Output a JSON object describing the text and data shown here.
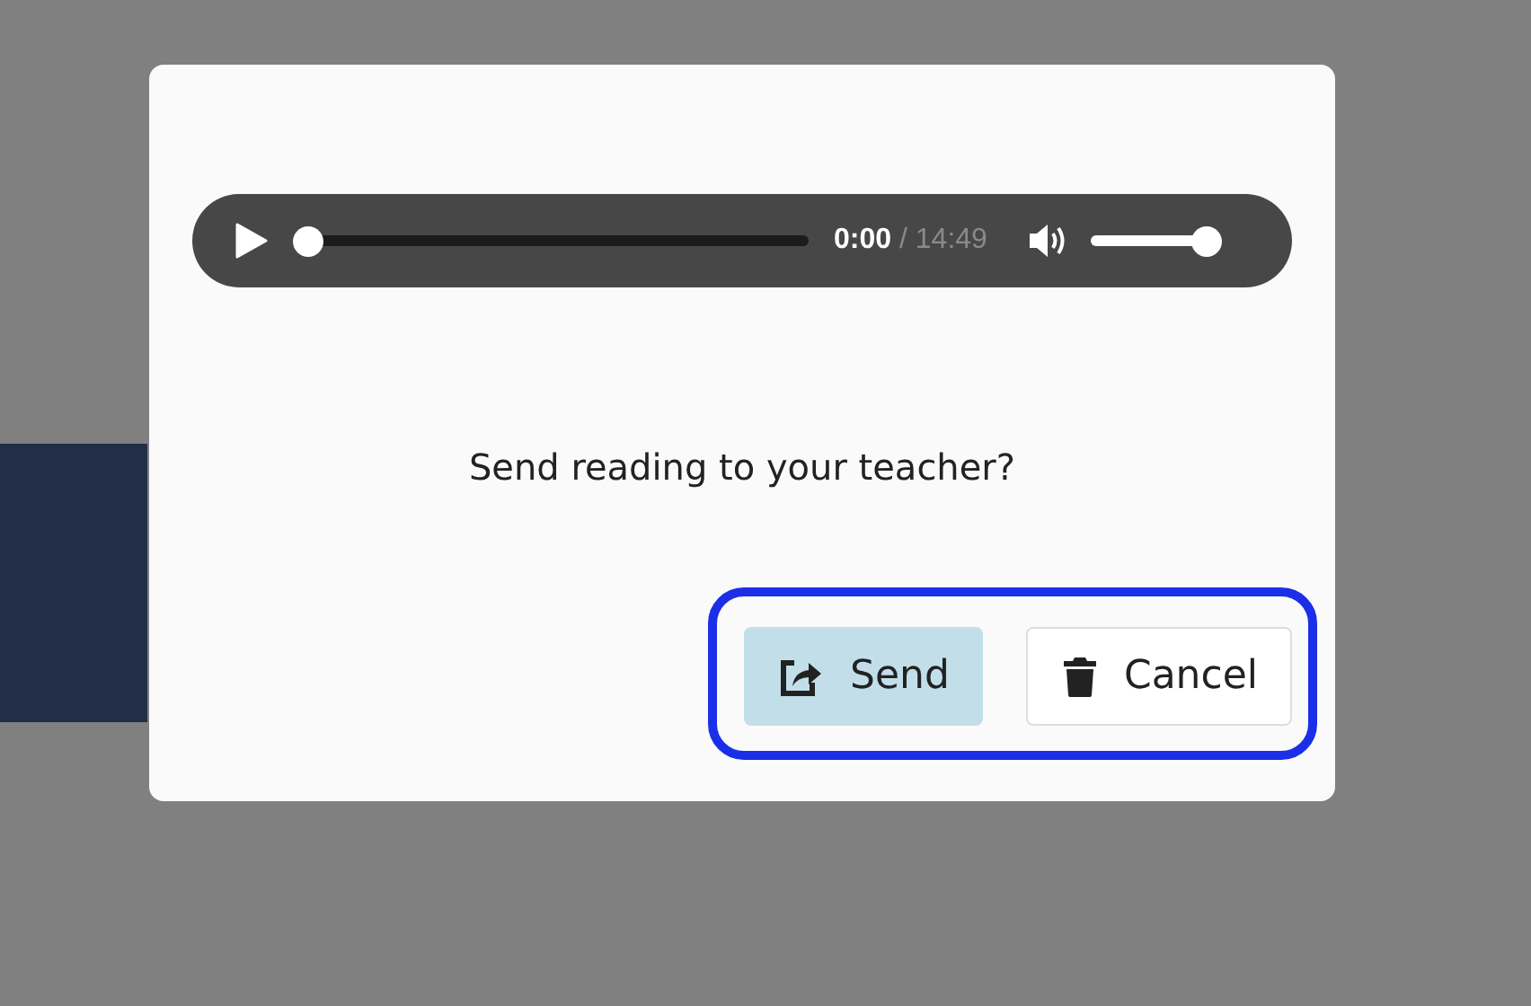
{
  "player": {
    "current_time": "0:00",
    "separator": "/",
    "duration": "14:49",
    "progress": {
      "level": 0.0
    },
    "volume": {
      "level": 1.0
    }
  },
  "message": "Send reading to your teacher?",
  "actions": {
    "highlighted": true,
    "buttons": [
      {
        "kind": "send",
        "label": "Send"
      },
      {
        "kind": "cancel",
        "label": "Cancel"
      }
    ]
  }
}
